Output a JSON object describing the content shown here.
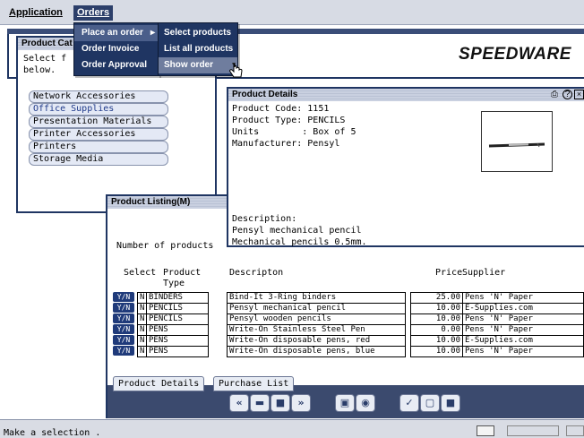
{
  "menubar": {
    "application": "Application",
    "orders": "Orders"
  },
  "orders_menu": {
    "items": [
      "Place an order",
      "Order Invoice",
      "Order Approval"
    ]
  },
  "place_order_submenu": {
    "items": [
      "Select products",
      "List all products",
      "Show order"
    ]
  },
  "brand": {
    "logo_text": "SPEEDWARE"
  },
  "catalog_window": {
    "title": "Product Cat",
    "intro_line1": "Select f",
    "intro_line2": "below.",
    "categories": [
      "Network Accessories",
      "Office Supplies",
      "Presentation Materials",
      "Printer Accessories",
      "Printers",
      "Storage Media"
    ]
  },
  "details_window": {
    "title": "Product Details",
    "code": "Product Code: 1151",
    "type": "Product Type: PENCILS",
    "units": "Units        : Box of 5",
    "manufacturer": "Manufacturer: Pensyl",
    "desc_label": "Description:",
    "desc1": "Pensyl mechanical pencil",
    "desc2": "Mechanical pencils 0.5mm."
  },
  "listing_window": {
    "title": "Product Listing(M)",
    "count_label": "Number of products",
    "headers": {
      "select": "Select",
      "product_type1": "Product",
      "product_type2": "Type",
      "description": "Descripton",
      "price": "Price",
      "supplier": "Supplier"
    },
    "rows": [
      {
        "yn": "Y/N",
        "flag": "N",
        "type": "BINDERS",
        "desc": "Bind-It 3-Ring binders",
        "price": "25.00",
        "supplier": "Pens 'N' Paper"
      },
      {
        "yn": "Y/N",
        "flag": "N",
        "type": "PENCILS",
        "desc": "Pensyl mechanical pencil",
        "price": "10.00",
        "supplier": "E-Supplies.com"
      },
      {
        "yn": "Y/N",
        "flag": "N",
        "type": "PENCILS",
        "desc": "Pensyl wooden pencils",
        "price": "10.00",
        "supplier": "Pens 'N' Paper"
      },
      {
        "yn": "Y/N",
        "flag": "N",
        "type": "PENS",
        "desc": "Write-On Stainless Steel Pen",
        "price": "0.00",
        "supplier": "Pens 'N' Paper"
      },
      {
        "yn": "Y/N",
        "flag": "N",
        "type": "PENS",
        "desc": "Write-On disposable pens, red",
        "price": "10.00",
        "supplier": "E-Supplies.com"
      },
      {
        "yn": "Y/N",
        "flag": "N",
        "type": "PENS",
        "desc": "Write-On disposable pens, blue",
        "price": "10.00",
        "supplier": "Pens 'N' Paper"
      }
    ],
    "tabs": [
      "Product Details",
      "Purchase List"
    ]
  },
  "statusbar": {
    "text": "Make a selection ."
  }
}
